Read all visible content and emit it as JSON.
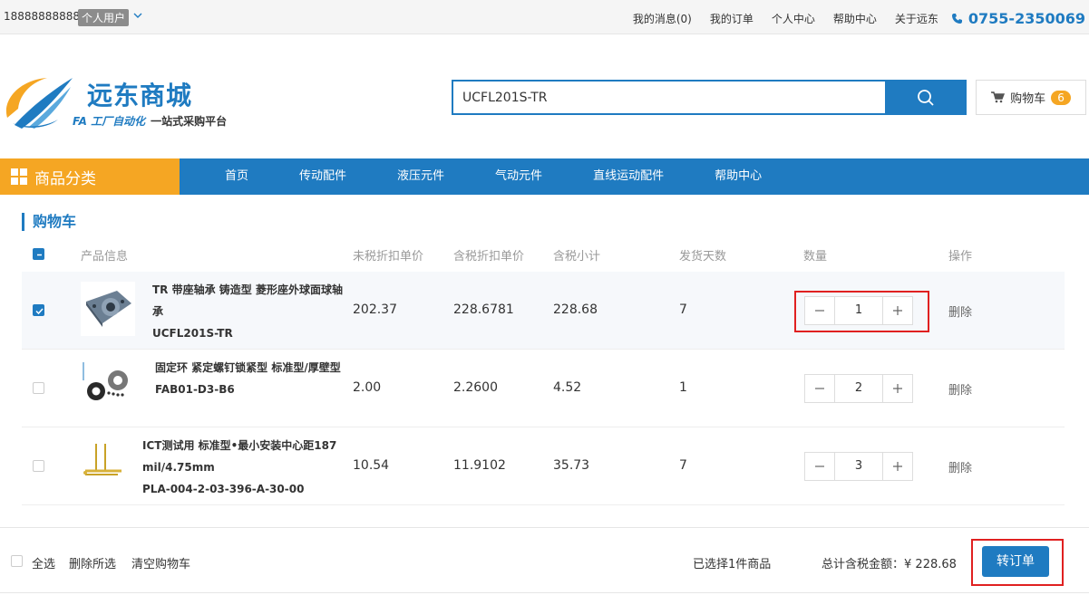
{
  "topbar": {
    "phone": "18888888888",
    "user_type": "个人用户",
    "links": [
      "我的消息(0)",
      "我的订单",
      "个人中心",
      "帮助中心",
      "关于远东"
    ],
    "hotline": "0755-2350069"
  },
  "header": {
    "logo_title": "远东商城",
    "logo_sub_left": "FA 工厂自动化",
    "logo_sub_right": "一站式采购平台",
    "search_value": "UCFL201S-TR",
    "cart_label": "购物车",
    "cart_count": "6"
  },
  "nav": {
    "category_label": "商品分类",
    "items": [
      "首页",
      "传动配件",
      "液压元件",
      "气动元件",
      "直线运动配件",
      "帮助中心"
    ]
  },
  "cart": {
    "title": "购物车",
    "headers": {
      "product": "产品信息",
      "price_ex_tax": "未税折扣单价",
      "price_inc_tax": "含税折扣单价",
      "subtotal": "含税小计",
      "days": "发货天数",
      "qty": "数量",
      "op": "操作"
    },
    "rows": [
      {
        "name": "TR 带座轴承 铸造型 菱形座外球面球轴承",
        "code": "UCFL201S-TR",
        "price_ex_tax": "202.37",
        "price_inc_tax": "228.6781",
        "subtotal": "228.68",
        "days": "7",
        "qty": "1",
        "delete": "删除",
        "checked": true
      },
      {
        "name": "固定环 紧定螺钉锁紧型 标准型/厚壁型",
        "code": "FAB01-D3-B6",
        "price_ex_tax": "2.00",
        "price_inc_tax": "2.2600",
        "subtotal": "4.52",
        "days": "1",
        "qty": "2",
        "delete": "删除",
        "checked": false
      },
      {
        "name": "ICT测试用 标准型•最小安装中心距187 mil/4.75mm",
        "code": "PLA-004-2-03-396-A-30-00",
        "price_ex_tax": "10.54",
        "price_inc_tax": "11.9102",
        "subtotal": "35.73",
        "days": "7",
        "qty": "3",
        "delete": "删除",
        "checked": false
      }
    ]
  },
  "footer": {
    "select_all": "全选",
    "delete_selected": "删除所选",
    "clear_cart": "清空购物车",
    "selected_count": "已选择1件商品",
    "total_label": "总计含税金额：",
    "total_value": "¥ 228.68",
    "order_button": "转订单"
  },
  "colors": {
    "primary": "#1f7bc1",
    "accent": "#f5a623",
    "highlight": "#e02020"
  }
}
